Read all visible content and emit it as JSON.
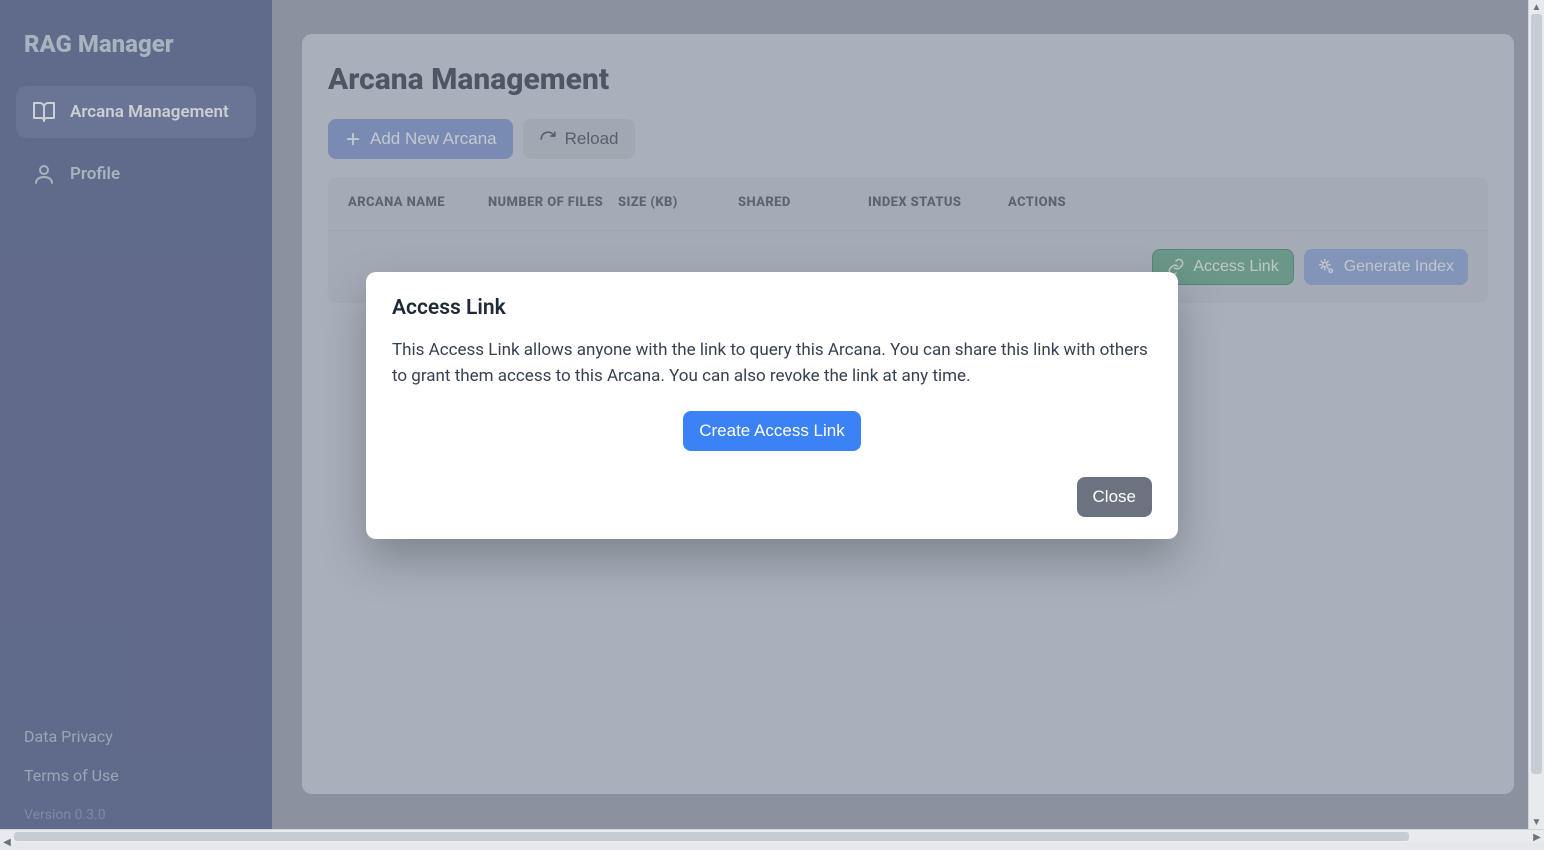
{
  "app": {
    "title": "RAG Manager"
  },
  "sidebar": {
    "items": [
      {
        "label": "Arcana Management"
      },
      {
        "label": "Profile"
      }
    ],
    "links": {
      "privacy": "Data Privacy",
      "terms": "Terms of Use"
    },
    "version": "Version 0.3.0"
  },
  "page": {
    "title": "Arcana Management",
    "toolbar": {
      "add_label": "Add New Arcana",
      "reload_label": "Reload"
    },
    "table": {
      "headers": {
        "name": "ARCANA NAME",
        "files": "NUMBER OF FILES",
        "size": "SIZE (KB)",
        "shared": "SHARED",
        "index": "INDEX STATUS",
        "actions": "ACTIONS"
      },
      "row_actions": {
        "access_link": "Access Link",
        "generate_index": "Generate Index"
      }
    }
  },
  "modal": {
    "title": "Access Link",
    "body": "This Access Link allows anyone with the link to query this Arcana. You can share this link with others to grant them access to this Arcana. You can also revoke the link at any time.",
    "create_label": "Create Access Link",
    "close_label": "Close"
  }
}
